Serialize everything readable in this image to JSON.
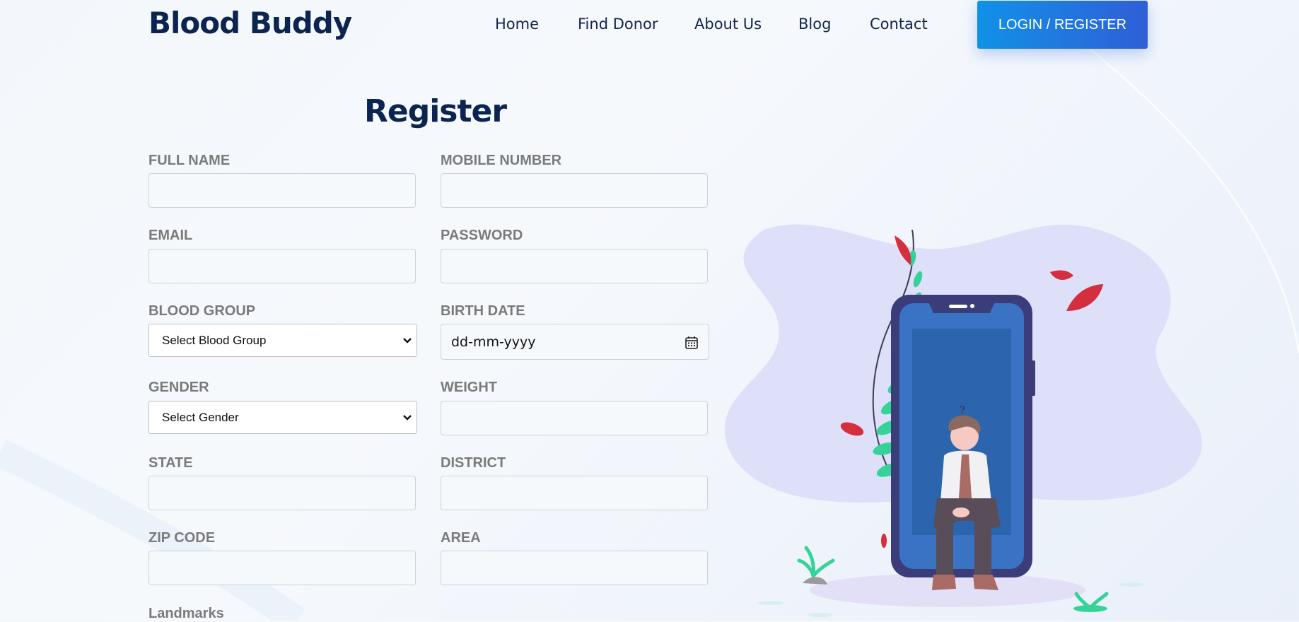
{
  "brand": {
    "name": "Blood Buddy"
  },
  "nav": {
    "items": [
      {
        "label": "Home"
      },
      {
        "label": "Find Donor"
      },
      {
        "label": "About Us"
      },
      {
        "label": "Blog"
      },
      {
        "label": "Contact"
      }
    ],
    "login_label": "LOGIN / REGISTER"
  },
  "form": {
    "title": "Register",
    "full_name_label": "FULL NAME",
    "mobile_label": "MOBILE NUMBER",
    "email_label": "EMAIL",
    "password_label": "PASSWORD",
    "blood_group_label": "BLOOD GROUP",
    "blood_group_selected": "Select Blood Group",
    "birth_date_label": "BIRTH DATE",
    "birth_date_placeholder": "dd-mm-yyyy",
    "gender_label": "GENDER",
    "gender_selected": "Select Gender",
    "weight_label": "WEIGHT",
    "state_label": "STATE",
    "district_label": "DISTRICT",
    "zip_label": "ZIP CODE",
    "area_label": "AREA",
    "landmarks_label": "Landmarks"
  },
  "illustration": {
    "question_mark": "?"
  },
  "colors": {
    "brand_navy": "#0c2450",
    "button_gradient_start": "#1191e8",
    "button_gradient_end": "#2f5fd6",
    "label_gray": "#7a7a7a"
  },
  "icons": {
    "select_arrow": "chevron-down-icon",
    "date_picker": "calendar-icon"
  }
}
